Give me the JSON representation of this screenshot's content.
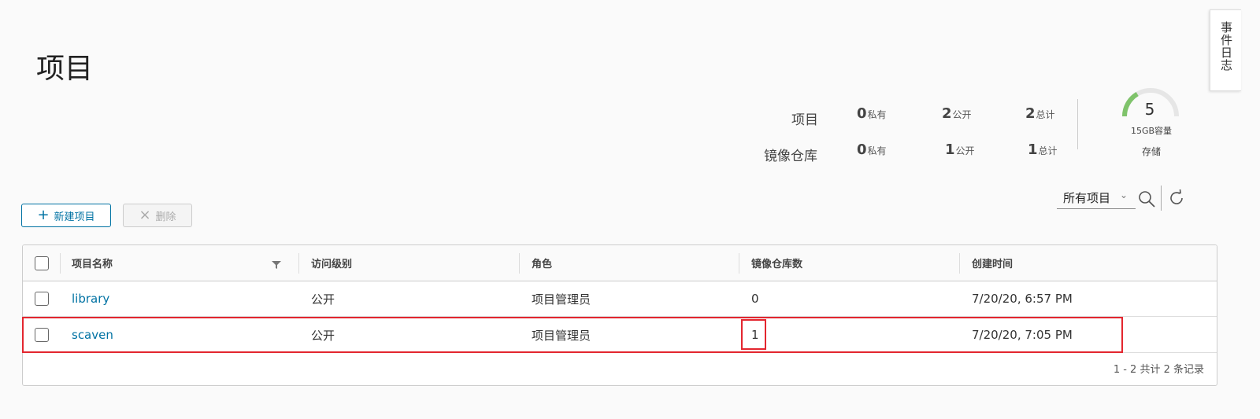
{
  "page": {
    "title": "项目"
  },
  "side_tab": {
    "label": "事件日志"
  },
  "stats": {
    "projects": {
      "label": "项目",
      "private": {
        "num": "0",
        "unit": "私有"
      },
      "public": {
        "num": "2",
        "unit": "公开"
      },
      "total": {
        "num": "2",
        "unit": "总计"
      }
    },
    "repositories": {
      "label": "镜像仓库",
      "private": {
        "num": "0",
        "unit": "私有"
      },
      "public": {
        "num": "1",
        "unit": "公开"
      },
      "total": {
        "num": "1",
        "unit": "总计"
      }
    },
    "storage": {
      "value": "5",
      "capacity": "15GB容量",
      "label": "存储",
      "usage_fraction": 0.33,
      "color": "#7fc36b"
    }
  },
  "toolbar": {
    "new_label": "新建项目",
    "delete_label": "删除",
    "filter_selected": "所有项目"
  },
  "table": {
    "columns": [
      "项目名称",
      "访问级别",
      "角色",
      "镜像仓库数",
      "创建时间"
    ],
    "rows": [
      {
        "name": "library",
        "access": "公开",
        "role": "项目管理员",
        "repo_count": "0",
        "created": "7/20/20, 6:57 PM"
      },
      {
        "name": "scaven",
        "access": "公开",
        "role": "项目管理员",
        "repo_count": "1",
        "created": "7/20/20, 7:05 PM"
      }
    ],
    "footer": "1 - 2 共计 2 条记录"
  },
  "colors": {
    "accent": "#0072a3",
    "highlight": "#e3262f"
  }
}
